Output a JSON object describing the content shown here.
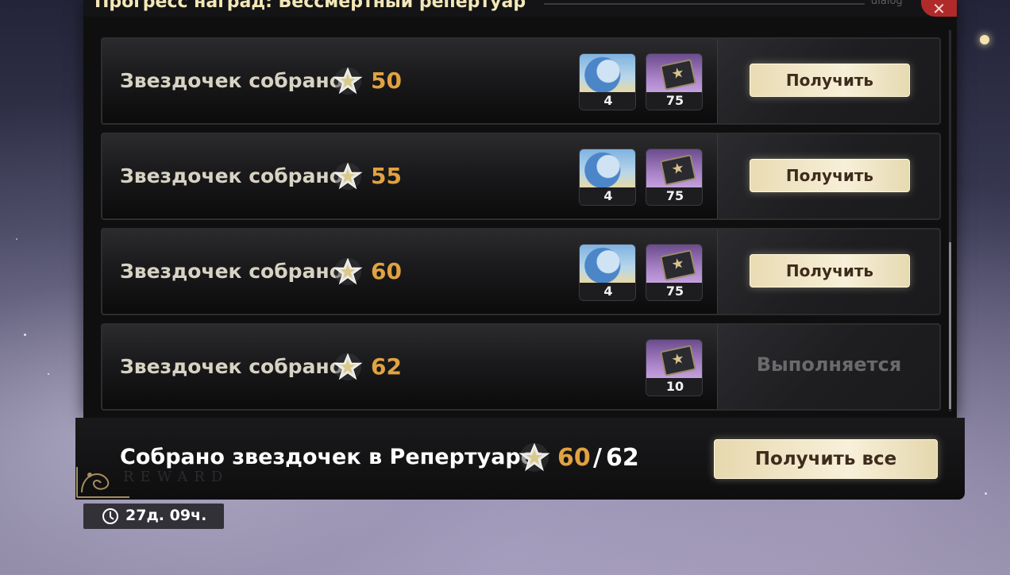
{
  "dialog": {
    "title": "Прогресс наград: Бессмертный репертуар",
    "tag": "dialog",
    "close_icon": "close-icon"
  },
  "rows": [
    {
      "label": "Звездочек собрано:",
      "value": "50",
      "items": [
        {
          "icon": "character-avatar-icon",
          "count": "4"
        },
        {
          "icon": "ticket-icon",
          "count": "75"
        }
      ],
      "action": "Получить",
      "state": "claimable"
    },
    {
      "label": "Звездочек собрано:",
      "value": "55",
      "items": [
        {
          "icon": "character-avatar-icon",
          "count": "4"
        },
        {
          "icon": "ticket-icon",
          "count": "75"
        }
      ],
      "action": "Получить",
      "state": "claimable"
    },
    {
      "label": "Звездочек собрано:",
      "value": "60",
      "items": [
        {
          "icon": "character-avatar-icon",
          "count": "4"
        },
        {
          "icon": "ticket-icon",
          "count": "75"
        }
      ],
      "action": "Получить",
      "state": "claimable"
    },
    {
      "label": "Звездочек собрано:",
      "value": "62",
      "items": [
        {
          "icon": "ticket-icon",
          "count": "10"
        }
      ],
      "action": "Выполняется",
      "state": "in-progress"
    }
  ],
  "footer": {
    "label": "Собрано звездочек в Репертуаре:",
    "current": "60",
    "separator": "/",
    "total": "62",
    "claim_all": "Получить все",
    "watermark": "REWARD"
  },
  "timer": {
    "text": "27д. 09ч.",
    "icon": "clock-icon"
  },
  "colors": {
    "accent_value": "#e1a241",
    "button_bg": "#f3e8c8",
    "button_text": "#3d2c1c",
    "close_bg": "#b02a2a"
  }
}
